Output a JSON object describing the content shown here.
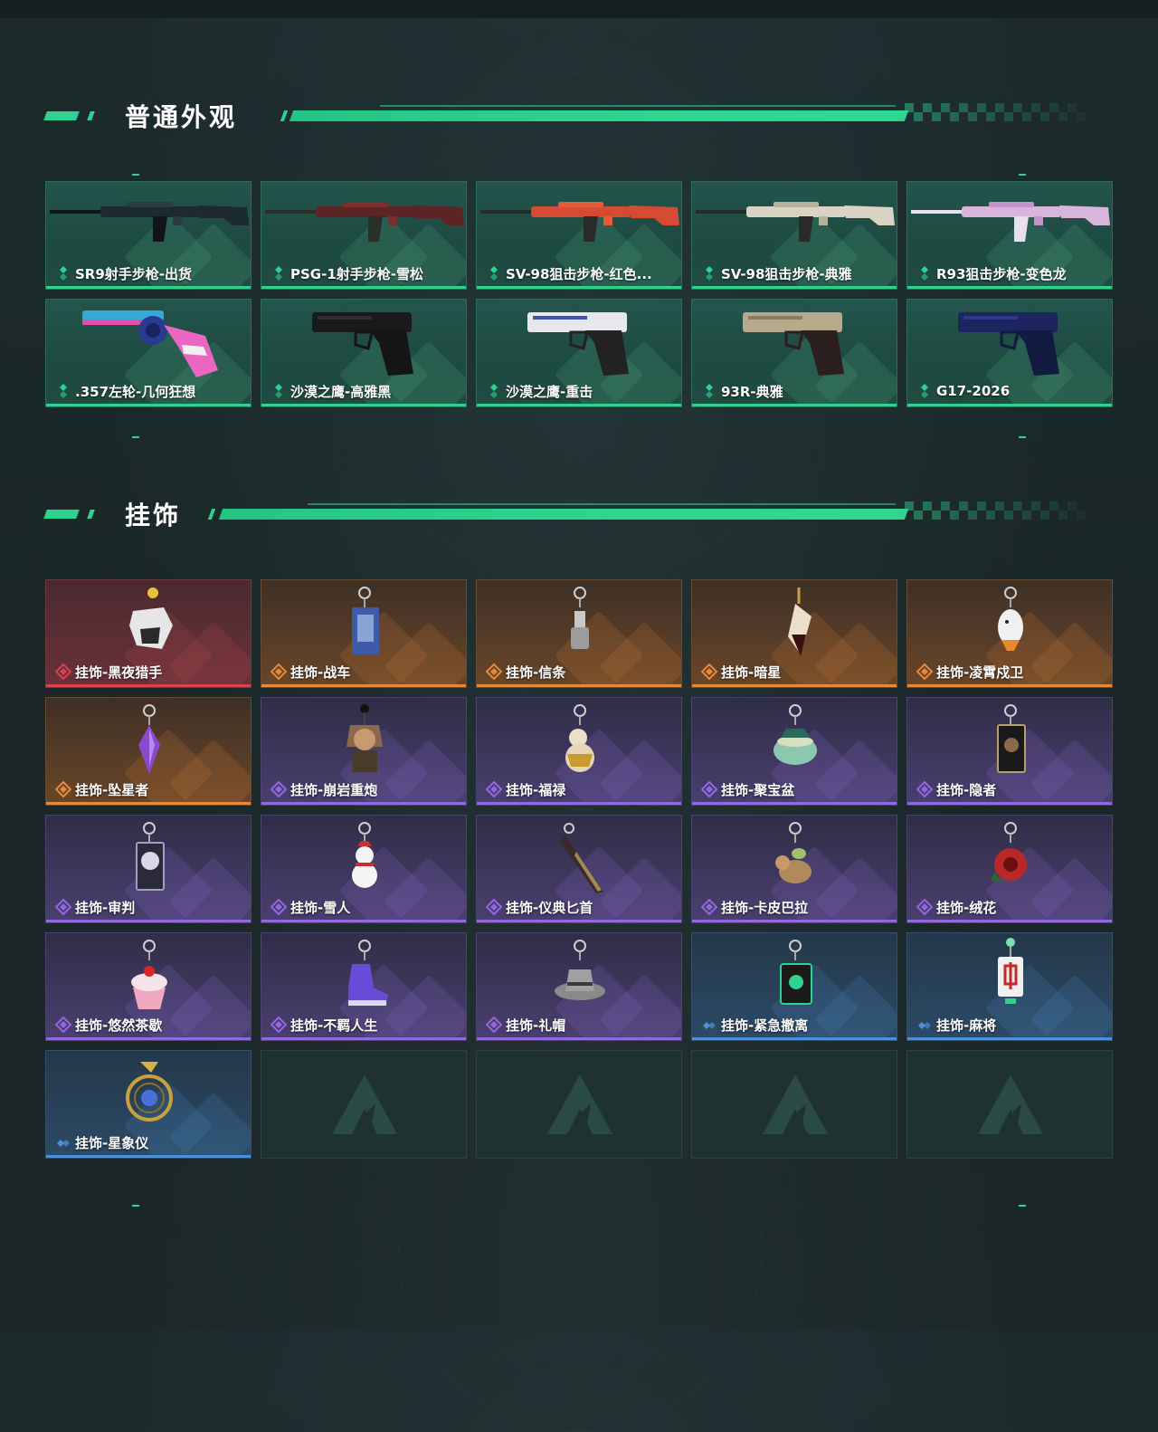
{
  "sections": {
    "skins": {
      "title": "普通外观"
    },
    "charms": {
      "title": "挂饰"
    }
  },
  "skins": [
    {
      "name": "SR9射手步枪-出货",
      "rarity": "green",
      "icon": "rifle-dark-icon"
    },
    {
      "name": "PSG-1射手步枪-雪松",
      "rarity": "green",
      "icon": "rifle-red-icon"
    },
    {
      "name": "SV-98狙击步枪-红色...",
      "rarity": "green",
      "icon": "sniper-red-icon"
    },
    {
      "name": "SV-98狙击步枪-典雅",
      "rarity": "green",
      "icon": "sniper-white-icon"
    },
    {
      "name": "R93狙击步枪-变色龙",
      "rarity": "green",
      "icon": "sniper-pink-icon"
    },
    {
      "name": ".357左轮-几何狂想",
      "rarity": "green",
      "icon": "revolver-pink-icon"
    },
    {
      "name": "沙漠之鹰-高雅黑",
      "rarity": "green",
      "icon": "pistol-black-icon"
    },
    {
      "name": "沙漠之鹰-重击",
      "rarity": "green",
      "icon": "pistol-white-icon"
    },
    {
      "name": "93R-典雅",
      "rarity": "green",
      "icon": "pistol-beige-icon"
    },
    {
      "name": "G17-2026",
      "rarity": "green",
      "icon": "pistol-blue-icon"
    }
  ],
  "charms": [
    {
      "name": "挂饰-黑夜猎手",
      "rarity": "red",
      "icon": "wolf-charm-icon"
    },
    {
      "name": "挂饰-战车",
      "rarity": "orange",
      "icon": "card-charm-icon"
    },
    {
      "name": "挂饰-信条",
      "rarity": "orange",
      "icon": "statue-charm-icon"
    },
    {
      "name": "挂饰-暗星",
      "rarity": "orange",
      "icon": "feather-charm-icon"
    },
    {
      "name": "挂饰-凌霄戍卫",
      "rarity": "orange",
      "icon": "bird-charm-icon"
    },
    {
      "name": "挂饰-坠星者",
      "rarity": "orange",
      "icon": "crystal-charm-icon"
    },
    {
      "name": "挂饰-崩岩重炮",
      "rarity": "purple",
      "icon": "figure-charm-icon"
    },
    {
      "name": "挂饰-福禄",
      "rarity": "purple",
      "icon": "gourd-charm-icon"
    },
    {
      "name": "挂饰-聚宝盆",
      "rarity": "purple",
      "icon": "treasure-bowl-charm-icon"
    },
    {
      "name": "挂饰-隐者",
      "rarity": "purple",
      "icon": "tarot-charm-icon"
    },
    {
      "name": "挂饰-审判",
      "rarity": "purple",
      "icon": "tarot-skull-charm-icon"
    },
    {
      "name": "挂饰-雪人",
      "rarity": "purple",
      "icon": "snowman-charm-icon"
    },
    {
      "name": "挂饰-仪典匕首",
      "rarity": "purple",
      "icon": "dagger-charm-icon"
    },
    {
      "name": "挂饰-卡皮巴拉",
      "rarity": "purple",
      "icon": "capybara-charm-icon"
    },
    {
      "name": "挂饰-绒花",
      "rarity": "purple",
      "icon": "flower-charm-icon"
    },
    {
      "name": "挂饰-悠然茶歇",
      "rarity": "purple",
      "icon": "cupcake-charm-icon"
    },
    {
      "name": "挂饰-不羁人生",
      "rarity": "purple",
      "icon": "sneaker-charm-icon"
    },
    {
      "name": "挂饰-礼帽",
      "rarity": "purple",
      "icon": "hat-charm-icon"
    },
    {
      "name": "挂饰-紧急撤离",
      "rarity": "blue",
      "icon": "green-box-charm-icon"
    },
    {
      "name": "挂饰-麻将",
      "rarity": "blue",
      "icon": "mahjong-charm-icon"
    },
    {
      "name": "挂饰-星象仪",
      "rarity": "blue",
      "icon": "astrolabe-charm-icon"
    }
  ],
  "empty_slots": 4,
  "colors": {
    "accent": "#2fd28f",
    "green": "#2dd48e",
    "red": "#d9424e",
    "orange": "#e68a3a",
    "purple": "#9367e0",
    "blue": "#4a91d8"
  }
}
